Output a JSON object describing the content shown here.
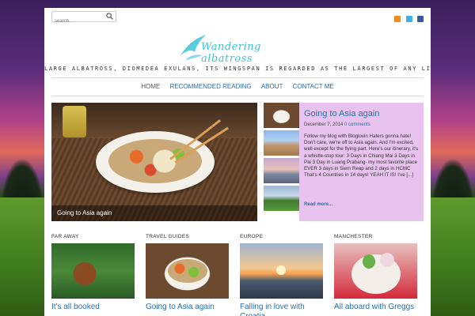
{
  "search": {
    "placeholder": "search..."
  },
  "social": [
    "rss-icon",
    "twitter-icon",
    "facebook-icon"
  ],
  "site": {
    "logo_text": "Wandering albatross",
    "tagline": "LARGE ALBATROSS, DIOMEDEA EXULANS, ITS WINGSPAN IS REGARDED AS THE LARGEST OF ANY LIVING BIRD"
  },
  "nav": {
    "home": "HOME",
    "recommended": "RECOMMENDED READING",
    "about": "ABOUT",
    "contact": "CONTACT ME"
  },
  "feature": {
    "caption": "Going to Asia again"
  },
  "post": {
    "title": "Going to Asia again",
    "date": "December 7, 2014",
    "comments": "0 comments",
    "body": "Follow my blog with Bloglovin Haters gonna hate! Don't care, we're off to Asia again. And I'm excited, well except for the flying part. Here's our itinerary, it's a whistle-stop tour: 3 Days in Chiang Mai 3 Days in Pai 3 Day in Luang Prabang- my most favorite place EVER 3 days in Siem Reap and 2 days in HCMC That's 4 Countries in 14 days! YEAH IT IS! I've [...]",
    "read_more": "Read more..."
  },
  "categories": [
    {
      "label": "FAR AWAY",
      "title": "It's all booked"
    },
    {
      "label": "TRAVEL GUIDES",
      "title": "Going to Asia again"
    },
    {
      "label": "EUROPE",
      "title": "Falling in love with Croatia"
    },
    {
      "label": "MANCHESTER",
      "title": "All aboard with Greggs"
    }
  ]
}
